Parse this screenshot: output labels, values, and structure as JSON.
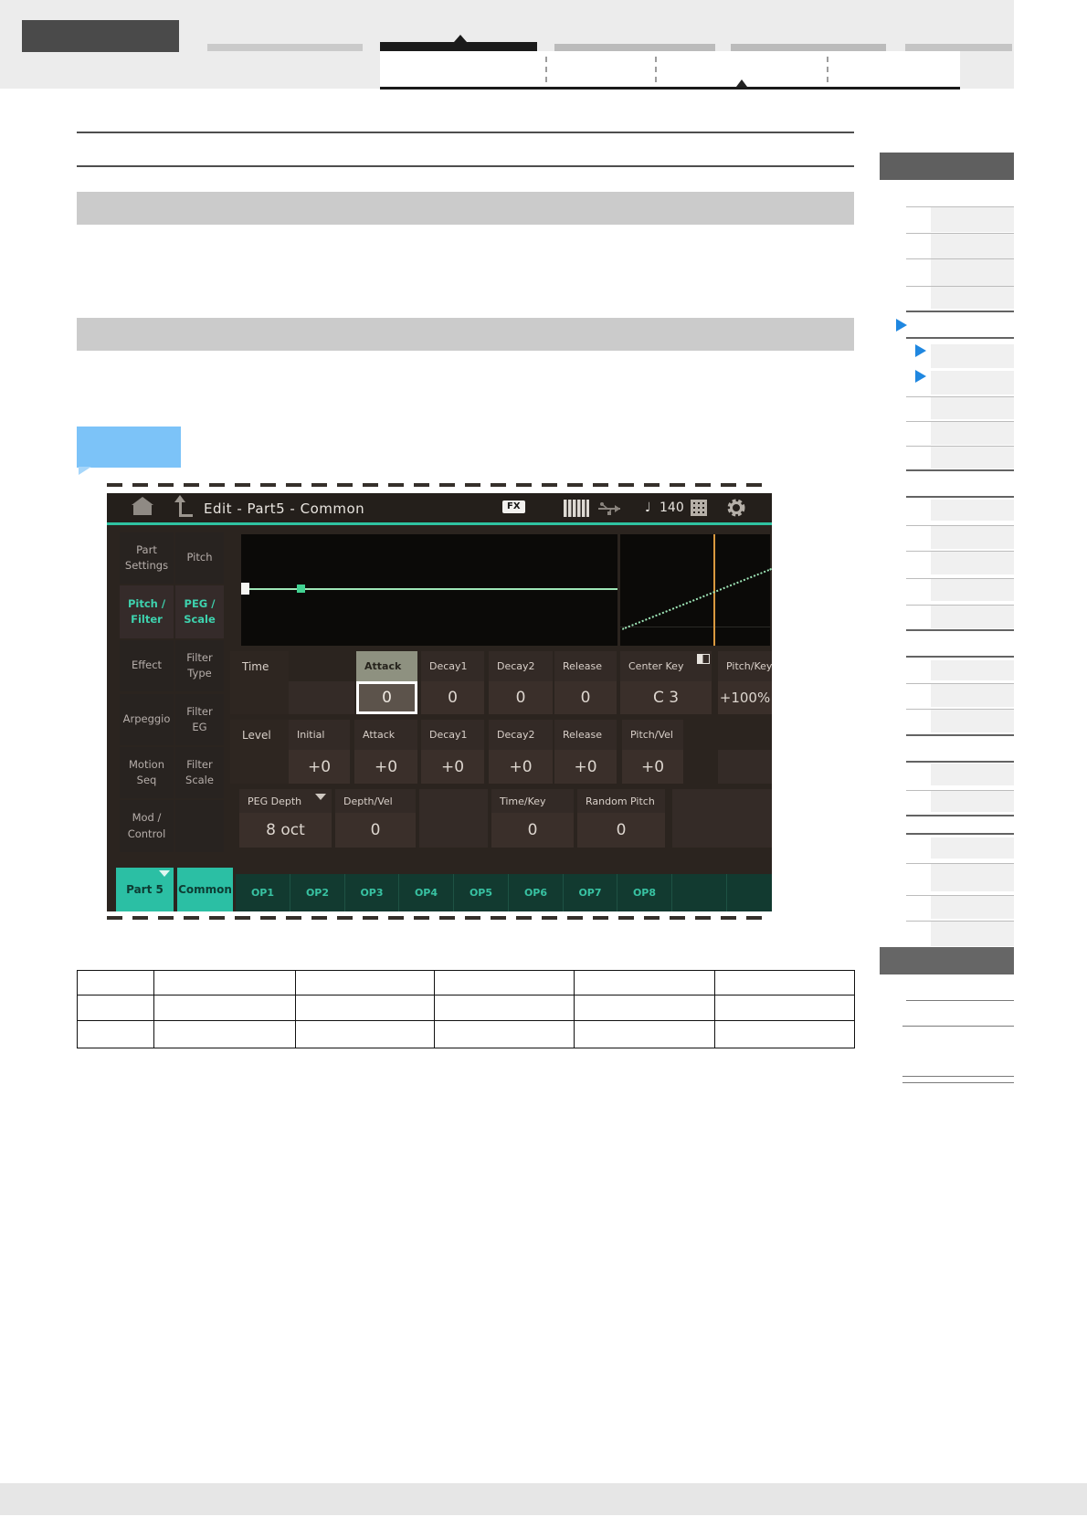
{
  "colors": {
    "accent_teal": "#2fc3a1",
    "toc_arrow_blue": "#1f87e0",
    "callout_blue": "#7cc3f8",
    "envelope_green": "#9fe7b8",
    "marker_orange": "#d9993f",
    "selected_param_header": "#8e9180"
  },
  "shot": {
    "titlebar": {
      "title": "Edit - Part5 - Common",
      "fx_badge": "FX",
      "note_glyph": "♩",
      "tempo": "140"
    },
    "nav": {
      "col1": [
        "Part\nSettings",
        "Pitch /\nFilter",
        "Effect",
        "Arpeggio",
        "Motion\nSeq",
        "Mod /\nControl"
      ],
      "col2": [
        "Pitch",
        "PEG /\nScale",
        "Filter\nType",
        "Filter\nEG",
        "Filter\nScale"
      ]
    },
    "params": {
      "time": {
        "row_label": "Time",
        "cols": [
          {
            "h": "Attack",
            "v": "0"
          },
          {
            "h": "Decay1",
            "v": "0"
          },
          {
            "h": "Decay2",
            "v": "0"
          },
          {
            "h": "Release",
            "v": "0"
          },
          {
            "h": "Center Key",
            "v": "C 3"
          },
          {
            "h": "Pitch/Key",
            "v": "+100%"
          }
        ]
      },
      "level": {
        "row_label": "Level",
        "cols": [
          {
            "h": "Initial",
            "v": "+0"
          },
          {
            "h": "Attack",
            "v": "+0"
          },
          {
            "h": "Decay1",
            "v": "+0"
          },
          {
            "h": "Decay2",
            "v": "+0"
          },
          {
            "h": "Release",
            "v": "+0"
          },
          {
            "h": "Pitch/Vel",
            "v": "+0"
          }
        ]
      },
      "depth": {
        "cols": [
          {
            "h": "PEG Depth",
            "v": "8 oct"
          },
          {
            "h": "Depth/Vel",
            "v": "0"
          },
          {
            "h": "Time/Key",
            "v": "0"
          },
          {
            "h": "Random Pitch",
            "v": "0"
          }
        ]
      }
    },
    "tabs": {
      "part": "Part 5",
      "common": "Common",
      "ops": [
        "OP1",
        "OP2",
        "OP3",
        "OP4",
        "OP5",
        "OP6",
        "OP7",
        "OP8"
      ]
    }
  }
}
